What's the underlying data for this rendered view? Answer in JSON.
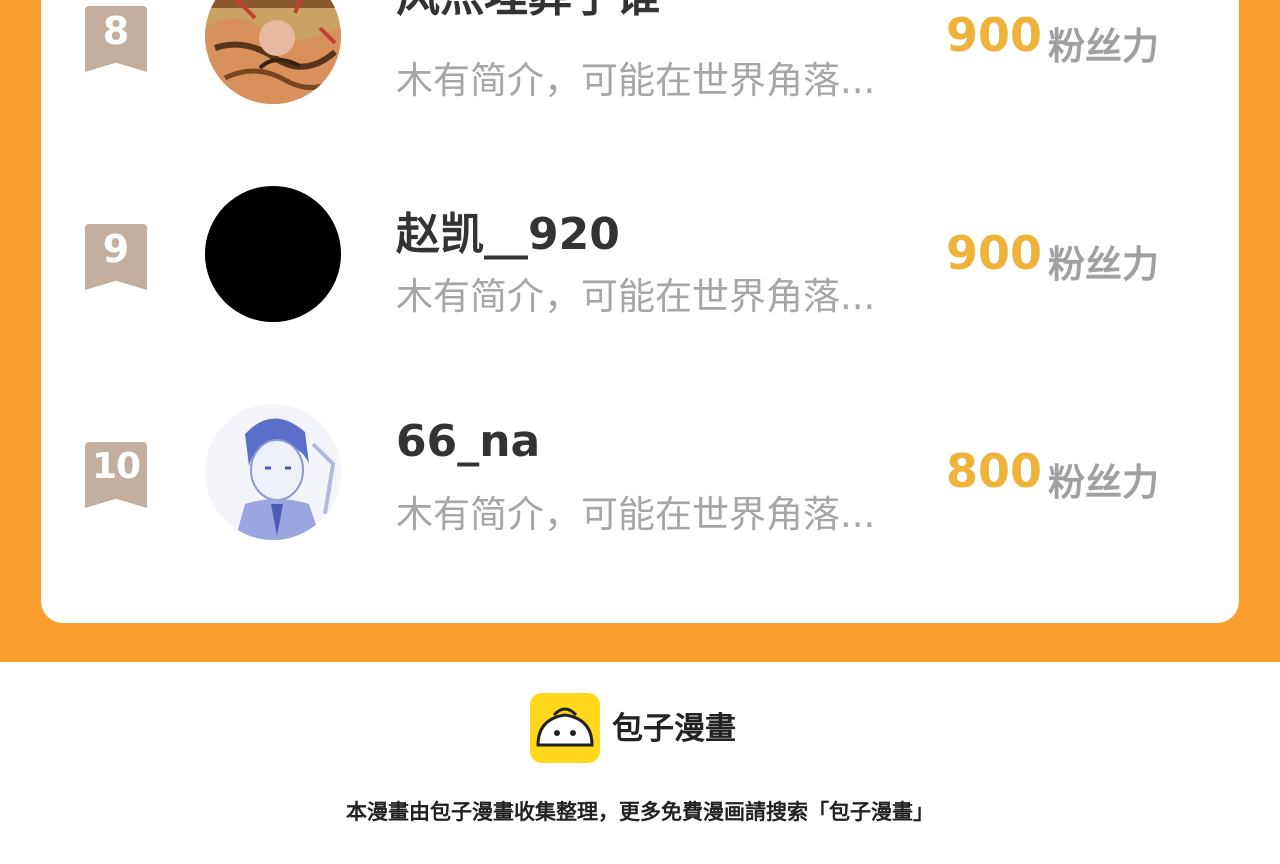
{
  "ranking": [
    {
      "rank": "8",
      "name": "风灬埋葬了谁",
      "bio": "木有简介，可能在世界角落...",
      "fans": "900",
      "fans_unit": "粉丝力",
      "avatar": "avatar-illustration"
    },
    {
      "rank": "9",
      "name": "赵凯__920",
      "bio": "木有简介，可能在世界角落...",
      "fans": "900",
      "fans_unit": "粉丝力",
      "avatar": "avatar-black-circle"
    },
    {
      "rank": "10",
      "name": "66_na",
      "bio": "木有简介，可能在世界角落...",
      "fans": "800",
      "fans_unit": "粉丝力",
      "avatar": "avatar-sketch"
    }
  ],
  "footer": {
    "brand_name": "包子漫畫",
    "logo_icon": "bun-face-icon",
    "note": "本漫畫由包子漫畫收集整理，更多免費漫画請搜索「包子漫畫」"
  },
  "colors": {
    "frame": "#fb9d2c",
    "fans_count": "#f0b33a",
    "badge": "#c4ae9e",
    "logo": "#ffd81b"
  }
}
